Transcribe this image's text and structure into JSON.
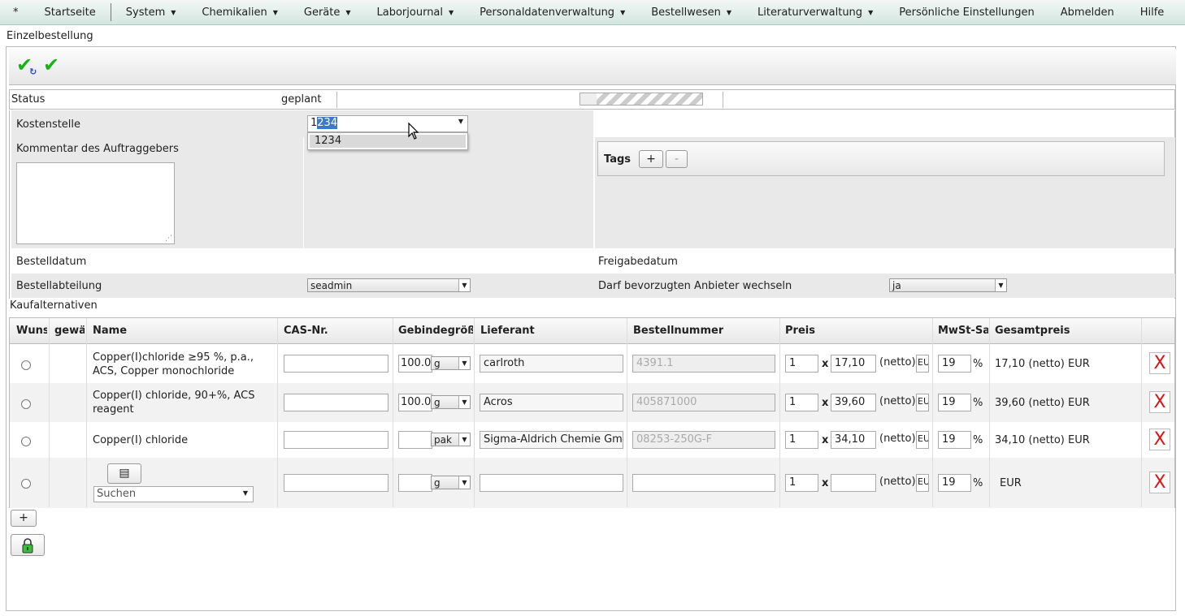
{
  "menu": {
    "star": "*",
    "items": [
      {
        "label": "Startseite",
        "dropdown": false
      },
      {
        "label": "System",
        "dropdown": true
      },
      {
        "label": "Chemikalien",
        "dropdown": true
      },
      {
        "label": "Geräte",
        "dropdown": true
      },
      {
        "label": "Laborjournal",
        "dropdown": true
      },
      {
        "label": "Personaldatenverwaltung",
        "dropdown": true
      },
      {
        "label": "Bestellwesen",
        "dropdown": true
      },
      {
        "label": "Literaturverwaltung",
        "dropdown": true
      },
      {
        "label": "Persönliche Einstellungen",
        "dropdown": false
      },
      {
        "label": "Abmelden",
        "dropdown": false
      },
      {
        "label": "Hilfe",
        "dropdown": false
      }
    ]
  },
  "page": {
    "title": "Einzelbestellung"
  },
  "status": {
    "label": "Status",
    "value": "geplant"
  },
  "form": {
    "kostenstelle_label": "Kostenstelle",
    "kostenstelle_typed": "1",
    "kostenstelle_selected": "234",
    "kostenstelle_option": "1234",
    "kommentar_label": "Kommentar des Auftraggebers",
    "tags_label": "Tags",
    "tag_add": "+",
    "tag_remove": "-",
    "bestelldatum_label": "Bestelldatum",
    "freigabedatum_label": "Freigabedatum",
    "bestellabteilung_label": "Bestellabteilung",
    "bestellabteilung_value": "seadmin",
    "anbieter_label": "Darf bevorzugten Anbieter wechseln",
    "anbieter_value": "ja"
  },
  "kauf": {
    "label": "Kaufalternativen",
    "headers": [
      "Wuns",
      "gewäl",
      "Name",
      "CAS-Nr.",
      "Gebindegröße",
      "Lieferant",
      "Bestellnummer",
      "Preis",
      "MwSt-Satz",
      "Gesamtpreis"
    ],
    "x_label": "x",
    "netto_label": "(netto)",
    "currency_short": "EU",
    "percent": "%",
    "delete_label": "X",
    "rows": [
      {
        "name": "Copper(I)chloride ≥95 %, p.a., ACS, Copper monochloride",
        "amount": "100.0",
        "unit": "g",
        "supplier": "carlroth",
        "order_no": "4391.1",
        "qty": "1",
        "price": "17,10",
        "vat": "19",
        "total": "17,10 (netto) EUR"
      },
      {
        "name": "Copper(I) chloride, 90+%, ACS reagent",
        "amount": "100.0",
        "unit": "g",
        "supplier": "Acros",
        "order_no": "405871000",
        "qty": "1",
        "price": "39,60",
        "vat": "19",
        "total": "39,60 (netto) EUR"
      },
      {
        "name": "Copper(I) chloride",
        "amount": "",
        "unit": "pak",
        "supplier": "Sigma-Aldrich Chemie GmbH",
        "order_no": "08253-250G-F",
        "qty": "1",
        "price": "34,10",
        "vat": "19",
        "total": "34,10 (netto) EUR"
      },
      {
        "name": "",
        "search_placeholder": "Suchen",
        "amount": "",
        "unit": "g",
        "supplier": "",
        "order_no": "",
        "qty": "1",
        "price": "",
        "vat": "19",
        "total": "EUR"
      }
    ],
    "add_row": "+"
  }
}
